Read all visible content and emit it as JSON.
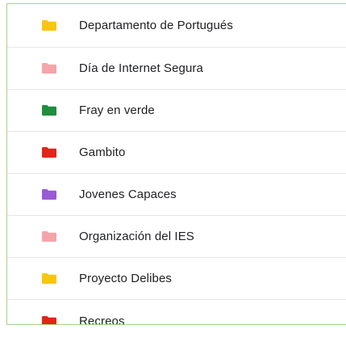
{
  "folders": [
    {
      "name": "Departamento de Portugués",
      "icon": "folder-icon",
      "color": "#f9c513"
    },
    {
      "name": "Día de Internet Segura",
      "icon": "folder-icon",
      "color": "#f4a5aa"
    },
    {
      "name": "Fray en verde",
      "icon": "folder-icon",
      "color": "#1e8e3e"
    },
    {
      "name": "Gambito",
      "icon": "folder-icon",
      "color": "#e3241b"
    },
    {
      "name": "Jovenes Capaces",
      "icon": "folder-icon",
      "color": "#9a5ad6"
    },
    {
      "name": "Organización del IES",
      "icon": "folder-icon",
      "color": "#f4a5aa"
    },
    {
      "name": "Proyecto Delibes",
      "icon": "folder-icon",
      "color": "#f9c513"
    },
    {
      "name": "Recreos",
      "icon": "folder-icon",
      "color": "#e3241b"
    }
  ]
}
